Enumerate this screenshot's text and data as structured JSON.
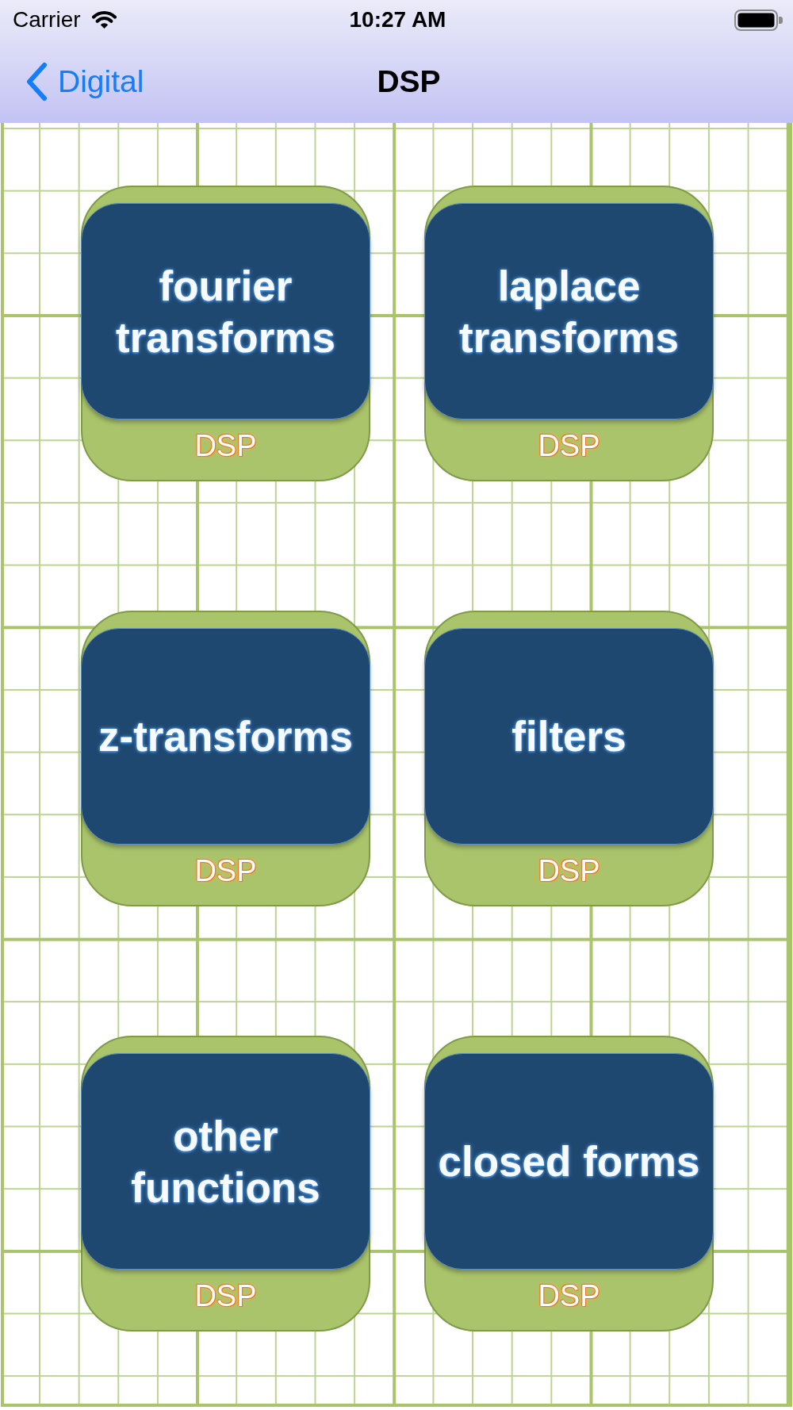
{
  "status_bar": {
    "carrier": "Carrier",
    "time": "10:27 AM"
  },
  "nav_bar": {
    "back_label": "Digital",
    "title": "DSP"
  },
  "tiles": [
    {
      "title": "fourier transforms",
      "label": "DSP"
    },
    {
      "title": "laplace transforms",
      "label": "DSP"
    },
    {
      "title": "z-transforms",
      "label": "DSP"
    },
    {
      "title": "filters",
      "label": "DSP"
    },
    {
      "title": "other functions",
      "label": "DSP"
    },
    {
      "title": "closed forms",
      "label": "DSP"
    }
  ]
}
